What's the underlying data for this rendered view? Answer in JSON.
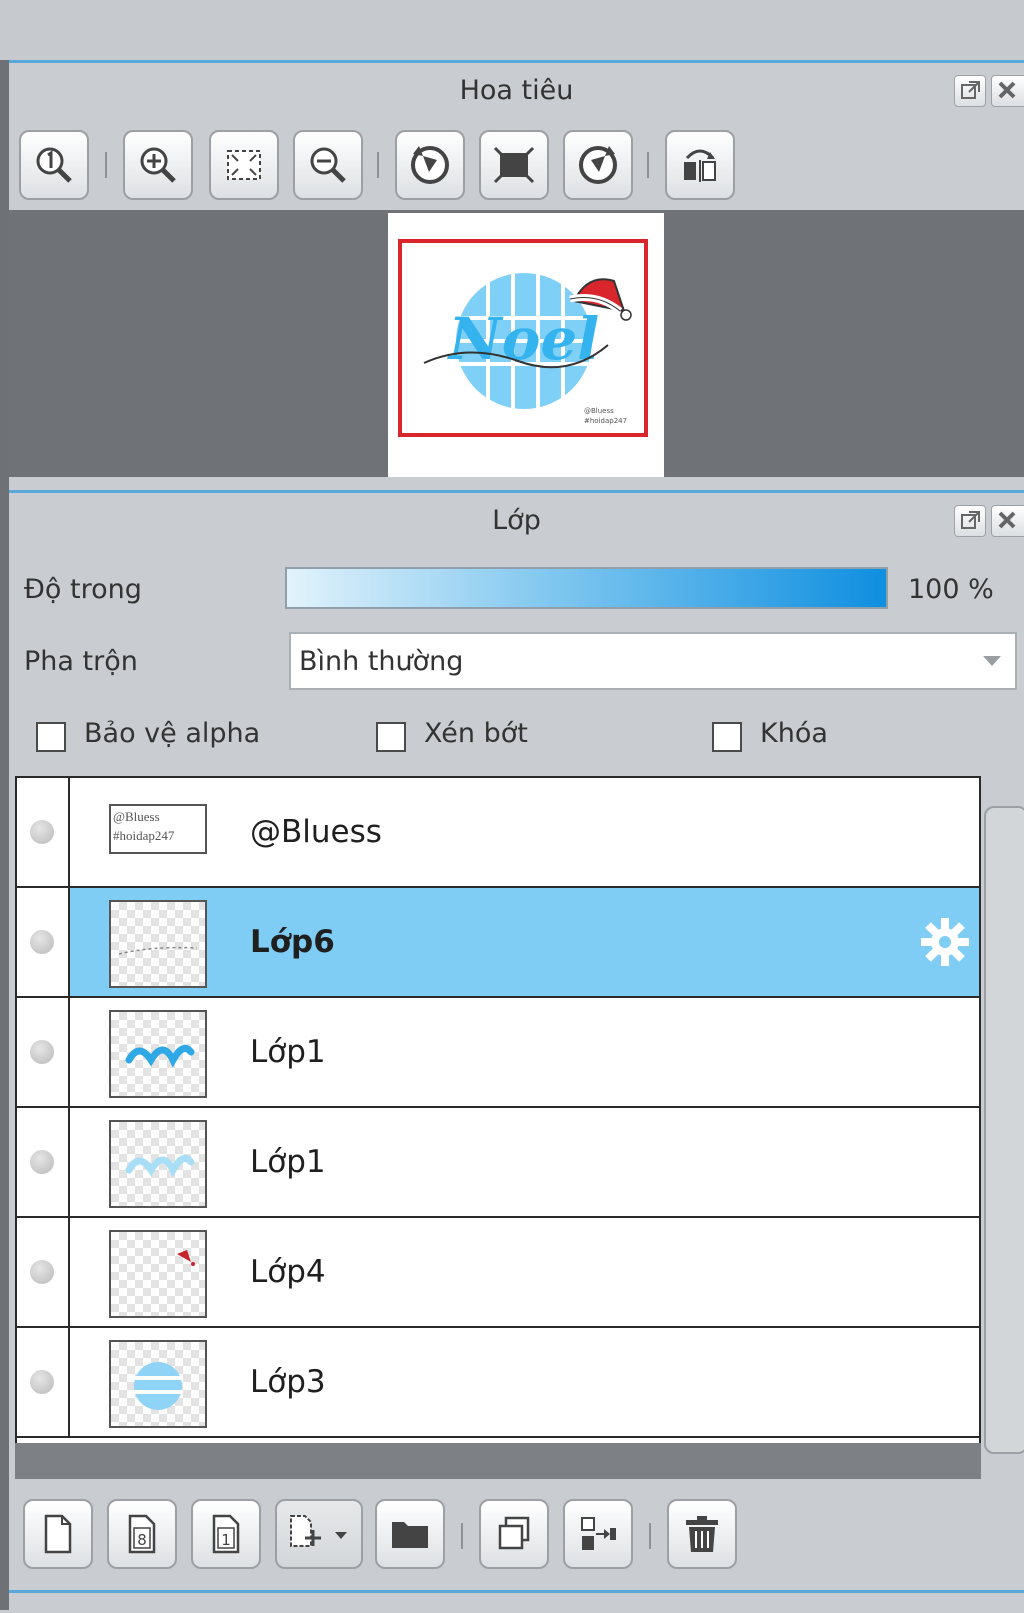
{
  "navigator": {
    "title": "Hoa tiêu",
    "toolbar": [
      {
        "icon": "zoom-actual-size-icon"
      },
      {
        "icon": "zoom-in-icon"
      },
      {
        "icon": "fit-to-window-icon"
      },
      {
        "icon": "zoom-out-icon"
      },
      {
        "icon": "rotate-left-icon"
      },
      {
        "icon": "reset-rotation-icon"
      },
      {
        "icon": "rotate-right-icon"
      },
      {
        "icon": "flip-horizontal-icon"
      }
    ],
    "preview": {
      "artwork_text": "Noel",
      "signature_line1": "@Bluess",
      "signature_line2": "#hoidap247",
      "frame_color": "#d9262c",
      "accent_color": "#35b3ef"
    }
  },
  "layers_panel": {
    "title": "Lớp",
    "opacity": {
      "label": "Độ trong",
      "value": 100,
      "display": "100 %"
    },
    "blend": {
      "label": "Pha trộn",
      "value": "Bình thường"
    },
    "checkboxes": [
      {
        "label": "Bảo vệ alpha",
        "checked": false
      },
      {
        "label": "Xén bớt",
        "checked": false
      },
      {
        "label": "Khóa",
        "checked": false
      }
    ],
    "layers": [
      {
        "name": "@Bluess",
        "thumb_line1": "@Bluess",
        "thumb_line2": "#hoidap247",
        "selected": false
      },
      {
        "name": "Lớp6",
        "selected": true
      },
      {
        "name": "Lớp1",
        "selected": false
      },
      {
        "name": "Lớp1",
        "selected": false
      },
      {
        "name": "Lớp4",
        "selected": false
      },
      {
        "name": "Lớp3",
        "selected": false
      }
    ],
    "toolbar": [
      {
        "icon": "new-layer-icon"
      },
      {
        "icon": "new-8bit-layer-icon"
      },
      {
        "icon": "new-1bit-layer-icon"
      },
      {
        "icon": "add-layer-dropdown-icon"
      },
      {
        "icon": "new-folder-icon"
      },
      {
        "icon": "duplicate-layer-icon"
      },
      {
        "icon": "merge-down-icon"
      },
      {
        "icon": "delete-layer-icon"
      }
    ]
  },
  "colors": {
    "selected_row": "#7fcdf4",
    "panel_bg": "#c9cdd1",
    "canvas_bg": "#6f7377",
    "header_line": "#5aa7da"
  }
}
